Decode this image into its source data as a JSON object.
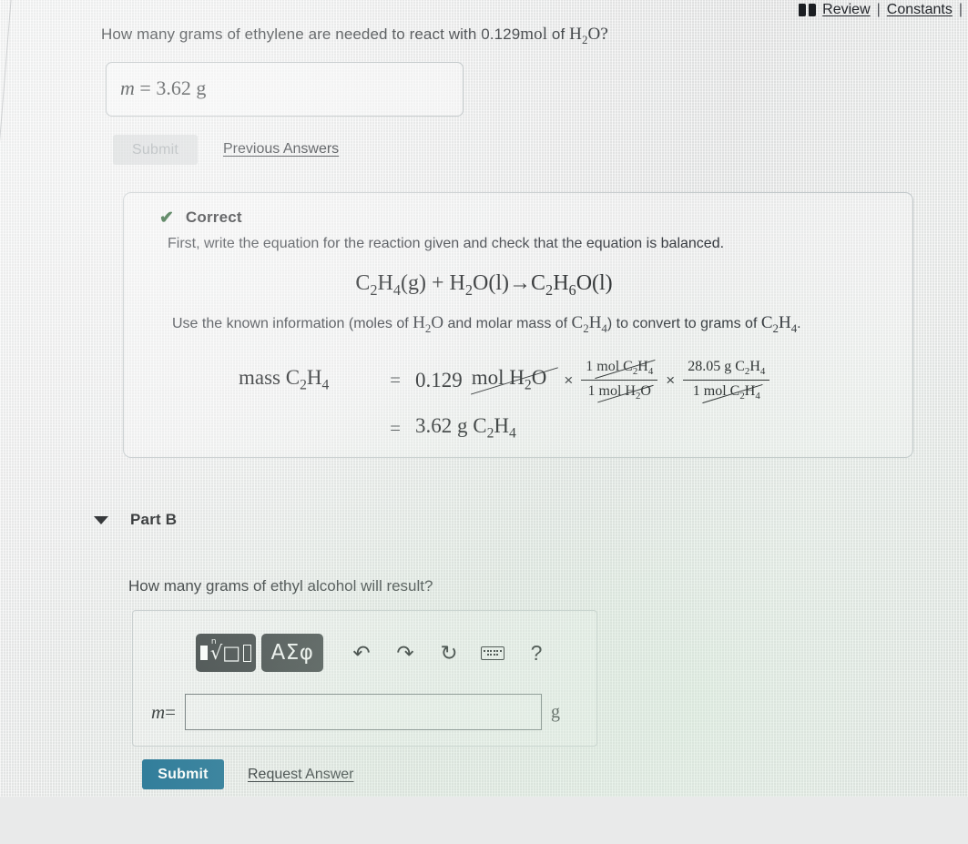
{
  "topbar": {
    "book_icon": "book-icon",
    "review_label": "Review",
    "separator": "|",
    "constants_label": "Constants",
    "trailing_separator": "|"
  },
  "part_a": {
    "question_prefix": "How many grams of ethylene are needed to react with ",
    "question_amount": "0.129",
    "question_unit": "mol",
    "question_of": " of ",
    "question_formula_h": "H",
    "question_formula_sub": "2",
    "question_formula_o": "O?",
    "answer_var": "m",
    "answer_equals": "=",
    "answer_value": "3.62",
    "answer_unit": "g",
    "submit_label": "Submit",
    "submit_disabled": true,
    "previous_answers_label": "Previous Answers"
  },
  "feedback": {
    "status_icon": "check-icon",
    "status_label": "Correct",
    "line1": "First, write the equation for the reaction given and check that the equation is balanced.",
    "equation": {
      "reactant1": "C2H4(g)",
      "plus": "+",
      "reactant2": "H2O(l)",
      "arrow": "→",
      "product": "C2H6O(l)"
    },
    "line2_part1": "Use the known information (moles of ",
    "line2_h2o": "H2O",
    "line2_part2": " and molar mass of ",
    "line2_c2h4": "C2H4",
    "line2_part3": ") to convert to grams of ",
    "line2_c2h4b": "C2H4",
    "line2_end": ".",
    "calculation": {
      "lhs_label": "mass",
      "lhs_formula": "C2H4",
      "equals": "=",
      "given_value": "0.129",
      "given_unit": "mol H2O",
      "times1": "×",
      "factor1_num": "1 mol C2H4",
      "factor1_den": "1 mol H2O",
      "times2": "×",
      "factor2_num": "28.05 g C2H4",
      "factor2_den": "1 mol C2H4",
      "result_equals": "=",
      "result_value": "3.62 g",
      "result_formula": "C2H4"
    }
  },
  "part_b": {
    "caret_icon": "caret-down-icon",
    "label": "Part B",
    "question": "How many grams of ethyl alcohol will result?",
    "toolbar": {
      "template_button": "template-sqrt-button",
      "greek_button": "ΑΣφ",
      "undo_icon": "↶",
      "redo_icon": "↷",
      "reset_icon": "↻",
      "keyboard_icon": "keyboard-icon",
      "help_icon": "?"
    },
    "answer_var": "m",
    "answer_equals": "=",
    "answer_value": "",
    "answer_placeholder": "",
    "answer_unit": "g",
    "submit_label": "Submit",
    "request_answer_label": "Request Answer"
  },
  "colors": {
    "submit_blue": "#1a6e92",
    "correct_green": "#15511f",
    "toolbar_dark": "#3a3f41",
    "page_background": "#e9eaea"
  }
}
